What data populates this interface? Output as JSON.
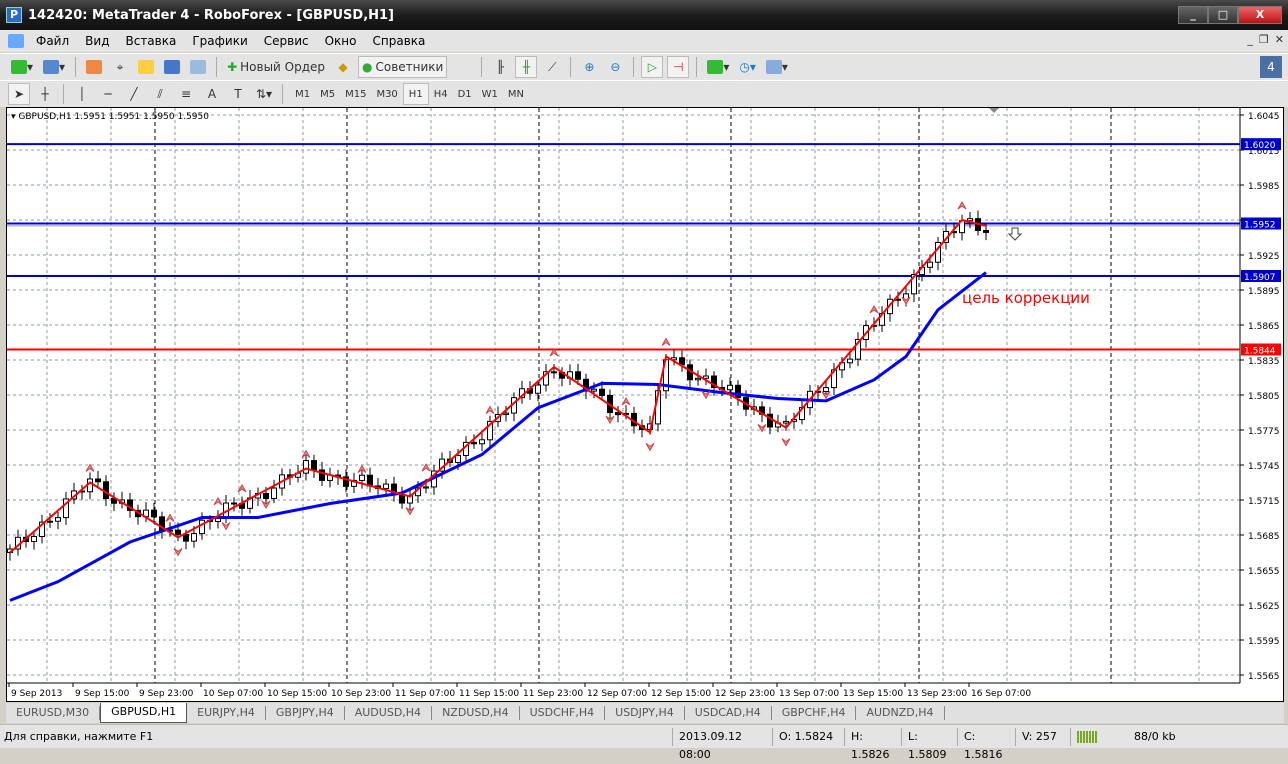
{
  "window": {
    "title": "142420: MetaTrader 4 - RoboForex - [GBPUSD,H1]",
    "minimize": "_",
    "maximize": "□",
    "close": "X"
  },
  "menu": [
    "Файл",
    "Вид",
    "Вставка",
    "Графики",
    "Сервис",
    "Окно",
    "Справка"
  ],
  "toolbar": {
    "new_order": "Новый Ордер",
    "advisors": "Советники",
    "notifications": "4"
  },
  "timeframes": [
    "M1",
    "M5",
    "M15",
    "M30",
    "H1",
    "H4",
    "D1",
    "W1",
    "MN"
  ],
  "active_timeframe": "H1",
  "chart": {
    "header": "GBPUSD,H1  1.5951 1.5951 1.5950 1.5950",
    "annotation": "цель коррекции",
    "annotation_color": "#ff0000",
    "price_ticks": [
      "1.6045",
      "1.6015",
      "1.5985",
      "1.5955",
      "1.5925",
      "1.5895",
      "1.5865",
      "1.5835",
      "1.5805",
      "1.5775",
      "1.5745",
      "1.5715",
      "1.5685",
      "1.5655",
      "1.5625",
      "1.5595",
      "1.5565"
    ],
    "time_labels": [
      "9 Sep 2013",
      "9 Sep 15:00",
      "9 Sep 23:00",
      "10 Sep 07:00",
      "10 Sep 15:00",
      "10 Sep 23:00",
      "11 Sep 07:00",
      "11 Sep 15:00",
      "11 Sep 23:00",
      "12 Sep 07:00",
      "12 Sep 15:00",
      "12 Sep 23:00",
      "13 Sep 07:00",
      "13 Sep 15:00",
      "13 Sep 23:00",
      "16 Sep 07:00"
    ],
    "levels": [
      {
        "price": 1.602,
        "label": "1.6020",
        "color": "#0000cc"
      },
      {
        "price": 1.5952,
        "label": "1.5952",
        "color": "#0000cc"
      },
      {
        "price": 1.5907,
        "label": "1.5907",
        "color": "#0000cc"
      },
      {
        "price": 1.5844,
        "label": "1.5844",
        "color": "#ff0000"
      }
    ],
    "zigzag": [
      [
        0,
        1.567
      ],
      [
        10,
        1.573
      ],
      [
        21,
        1.5683
      ],
      [
        37,
        1.5742
      ],
      [
        50,
        1.5718
      ],
      [
        68,
        1.5829
      ],
      [
        80,
        1.5773
      ],
      [
        82,
        1.5838
      ],
      [
        97,
        1.5777
      ],
      [
        119,
        1.5955
      ],
      [
        122,
        1.595
      ]
    ],
    "moving_average": [
      [
        0,
        1.5629
      ],
      [
        6,
        1.5645
      ],
      [
        15,
        1.5679
      ],
      [
        24,
        1.57
      ],
      [
        31,
        1.57
      ],
      [
        40,
        1.5712
      ],
      [
        49,
        1.5721
      ],
      [
        59,
        1.5754
      ],
      [
        66,
        1.5794
      ],
      [
        74,
        1.5815
      ],
      [
        81,
        1.5814
      ],
      [
        89,
        1.5807
      ],
      [
        96,
        1.5802
      ],
      [
        102,
        1.58
      ],
      [
        108,
        1.5818
      ],
      [
        112,
        1.5838
      ],
      [
        116,
        1.5878
      ],
      [
        122,
        1.591
      ]
    ],
    "fractals_up": [
      10,
      20,
      26,
      29,
      37,
      44,
      52,
      60,
      68,
      77,
      82,
      108,
      119
    ],
    "fractals_down": [
      21,
      27,
      32,
      50,
      75,
      80,
      87,
      94,
      97,
      102,
      112
    ]
  },
  "tabs": [
    "EURUSD,M30",
    "GBPUSD,H1",
    "EURJPY,H4",
    "GBPJPY,H4",
    "AUDUSD,H4",
    "NZDUSD,H4",
    "USDCHF,H4",
    "USDJPY,H4",
    "USDCAD,H4",
    "GBPCHF,H4",
    "AUDNZD,H4"
  ],
  "active_tab": "GBPUSD,H1",
  "status": {
    "help": "Для справки, нажмите F1",
    "datetime": "2013.09.12 08:00",
    "open": "O: 1.5824",
    "high": "H: 1.5826",
    "low": "L: 1.5809",
    "close": "C: 1.5816",
    "volume": "V: 257",
    "traffic": "88/0 kb"
  }
}
